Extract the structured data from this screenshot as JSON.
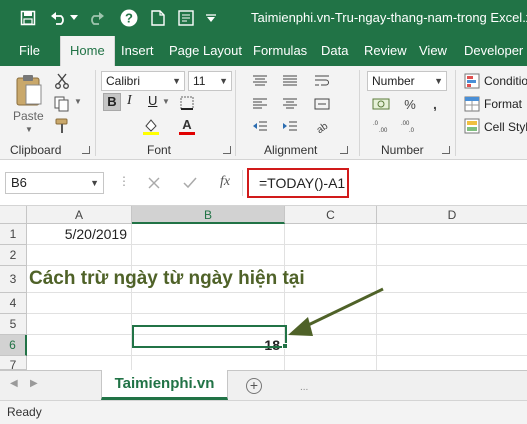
{
  "title": "Taimienphi.vn-Tru-ngay-thang-nam-trong Excel.xlsx",
  "tabs": [
    "File",
    "Home",
    "Insert",
    "Page Layout",
    "Formulas",
    "Data",
    "Review",
    "View",
    "Developer"
  ],
  "active_tab": "Home",
  "ribbon": {
    "clipboard": {
      "paste_label": "Paste",
      "group_label": "Clipboard"
    },
    "font": {
      "family": "Calibri",
      "size": "11",
      "bold": "B",
      "italic": "I",
      "underline": "U",
      "group_label": "Font"
    },
    "alignment": {
      "group_label": "Alignment"
    },
    "number": {
      "format": "Number",
      "group_label": "Number"
    },
    "styles": {
      "conditional": "Conditio",
      "format_as": "Format",
      "cell_styles": "Cell Styl"
    }
  },
  "formula_bar": {
    "name_box": "B6",
    "fx": "fx",
    "formula": "=TODAY()-A1"
  },
  "grid": {
    "columns": [
      "A",
      "B",
      "C",
      "D"
    ],
    "rows": [
      "1",
      "2",
      "3",
      "4",
      "5",
      "6",
      "7"
    ],
    "selected_column": "B",
    "selected_row": "6",
    "cells": {
      "A1": "5/20/2019",
      "B6": "18"
    },
    "annotation": "Cách trừ ngày từ ngày hiện tại"
  },
  "sheet_tabs": {
    "active": "Taimienphi.vn",
    "add_symbol": "+",
    "more": "..."
  },
  "status": {
    "text": "Ready"
  },
  "colors": {
    "excel_green": "#217346",
    "highlight_red": "#d11a1a",
    "annotation_green": "#4f6228"
  }
}
